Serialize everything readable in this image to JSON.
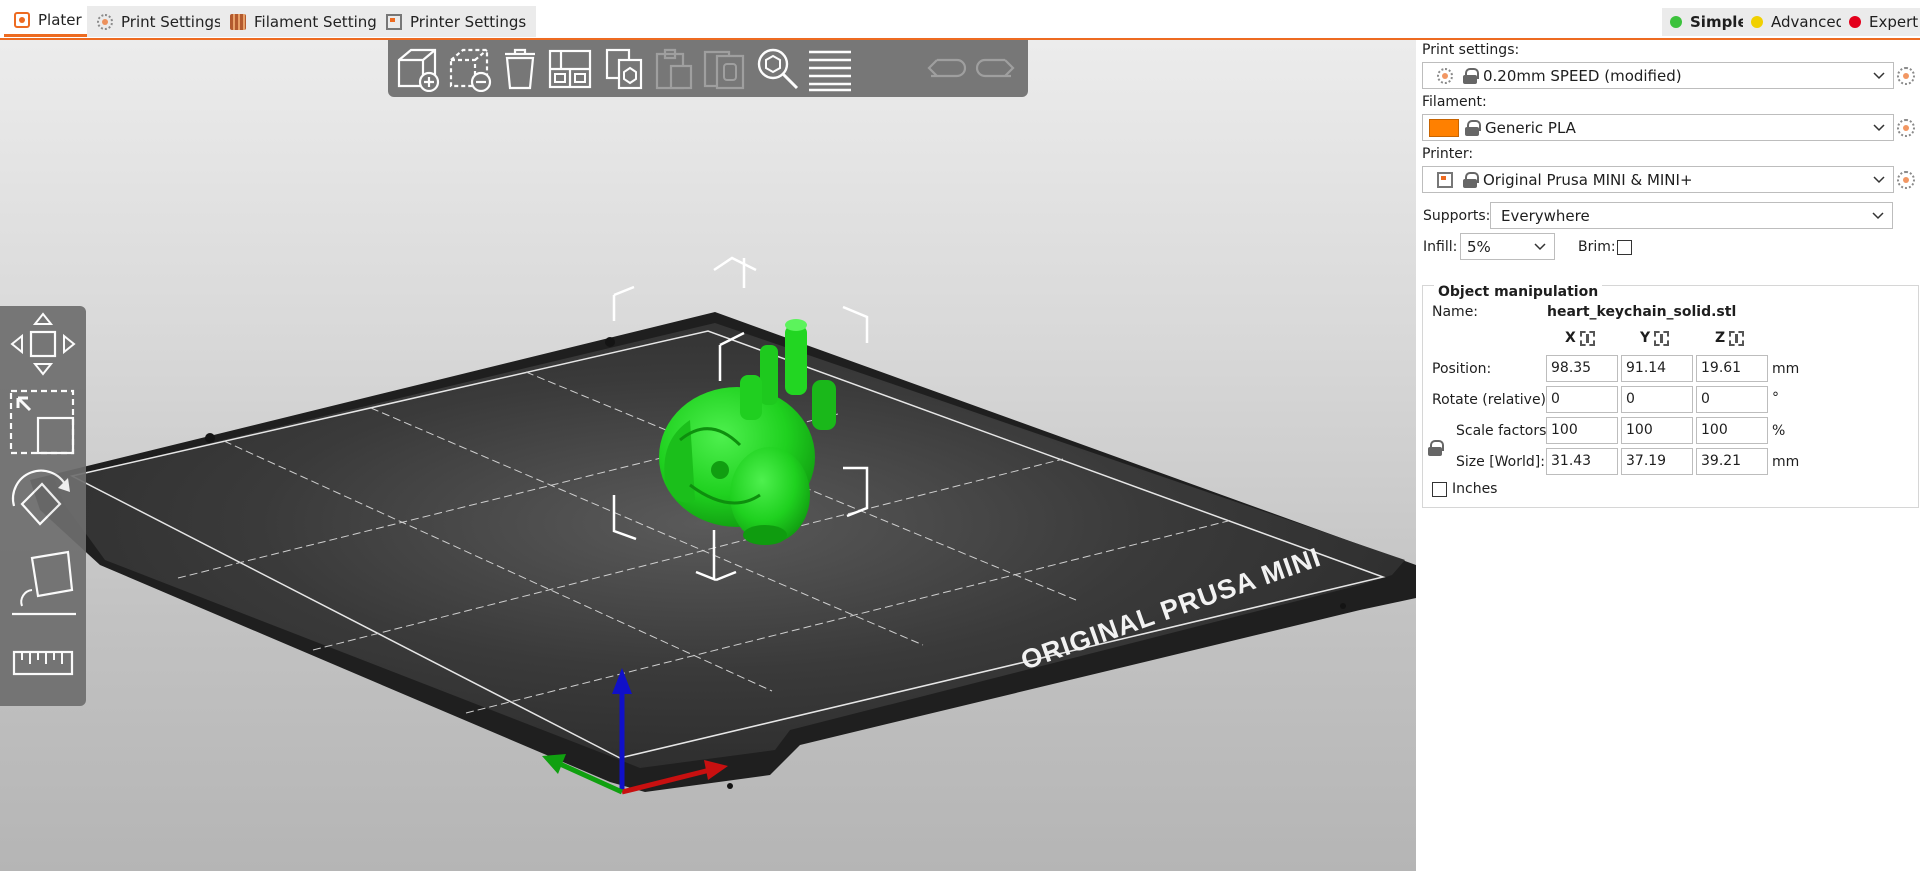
{
  "tabs": [
    {
      "label": "Plater",
      "active": true
    },
    {
      "label": "Print Settings",
      "active": false
    },
    {
      "label": "Filament Settings",
      "active": false
    },
    {
      "label": "Printer Settings",
      "active": false
    }
  ],
  "modes": [
    {
      "label": "Simple",
      "color": "#3cc23c",
      "active": true
    },
    {
      "label": "Advanced",
      "color": "#f0d000",
      "active": false
    },
    {
      "label": "Expert",
      "color": "#e3001b",
      "active": false
    }
  ],
  "bed_label": "ORIGINAL PRUSA MINI",
  "model_color": "#1fd11f",
  "accent": "#ed6b21",
  "panel": {
    "print_settings_label": "Print settings:",
    "print_settings_value": "0.20mm SPEED (modified)",
    "filament_label": "Filament:",
    "filament_value": "Generic PLA",
    "filament_color": "#ff8000",
    "printer_label": "Printer:",
    "printer_value": "Original Prusa MINI & MINI+",
    "supports_label": "Supports:",
    "supports_value": "Everywhere",
    "infill_label": "Infill:",
    "infill_value": "5%",
    "brim_label": "Brim:"
  },
  "object_manipulation": {
    "title": "Object manipulation",
    "name_label": "Name:",
    "name_value": "heart_keychain_solid.stl",
    "axes": [
      "X",
      "Y",
      "Z"
    ],
    "position_label": "Position:",
    "position": [
      "98.35",
      "91.14",
      "19.61"
    ],
    "position_unit": "mm",
    "rotate_label": "Rotate (relative):",
    "rotate": [
      "0",
      "0",
      "0"
    ],
    "rotate_unit": "°",
    "scale_label": "Scale factors:",
    "scale": [
      "100",
      "100",
      "100"
    ],
    "scale_unit": "%",
    "size_label": "Size [World]:",
    "size": [
      "31.43",
      "37.19",
      "39.21"
    ],
    "size_unit": "mm",
    "inches_label": "Inches"
  }
}
